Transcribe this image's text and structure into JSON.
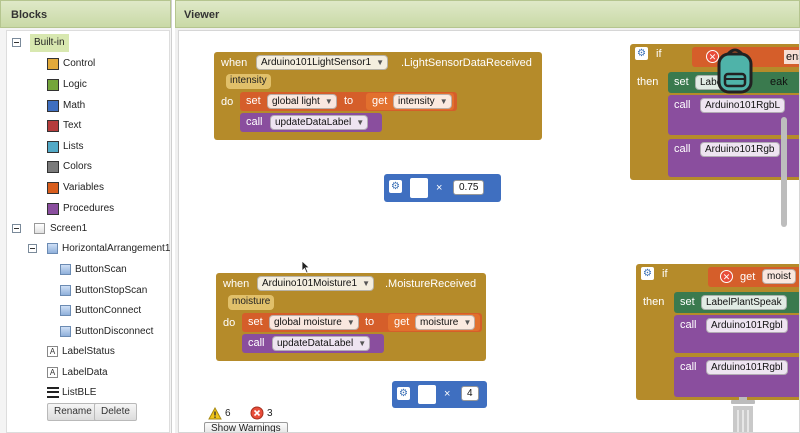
{
  "blocks_panel": {
    "title": "Blocks",
    "builtin": {
      "label": "Built-in",
      "categories": [
        {
          "label": "Control",
          "color": "#e1a93a"
        },
        {
          "label": "Logic",
          "color": "#74a53b"
        },
        {
          "label": "Math",
          "color": "#3f6fc0"
        },
        {
          "label": "Text",
          "color": "#b53c3c"
        },
        {
          "label": "Lists",
          "color": "#52a9c6"
        },
        {
          "label": "Colors",
          "color": "#7a7a7a"
        },
        {
          "label": "Variables",
          "color": "#d85d1d"
        },
        {
          "label": "Procedures",
          "color": "#8a4e9e"
        }
      ]
    },
    "screen": {
      "label": "Screen1",
      "arrangement": "HorizontalArrangement1",
      "buttons": [
        "ButtonScan",
        "ButtonStopScan",
        "ButtonConnect",
        "ButtonDisconnect"
      ],
      "labels": [
        "LabelStatus",
        "LabelData"
      ],
      "list": "ListBLE"
    },
    "rename_button": "Rename",
    "delete_button": "Delete"
  },
  "viewer": {
    "title": "Viewer",
    "event1": {
      "when": "when",
      "component": "Arduino101LightSensor1",
      "event": ".LightSensorDataReceived",
      "param": "intensity",
      "do": "do",
      "set": "set",
      "variable": "global light",
      "to": "to",
      "get": "get",
      "get_value": "intensity",
      "call": "call",
      "procedure": "updateDataLabel"
    },
    "multiply1": {
      "operator": "×",
      "value": "0.75"
    },
    "event2": {
      "when": "when",
      "component": "Arduino101Moisture1",
      "event": ".MoistureReceived",
      "param": "moisture",
      "do": "do",
      "set": "set",
      "variable": "global moisture",
      "to": "to",
      "get": "get",
      "get_value": "moisture",
      "call": "call",
      "procedure": "updateDataLabel"
    },
    "multiply2": {
      "operator": "×",
      "value": "4"
    },
    "right_block1": {
      "if": "if",
      "then": "then",
      "condition_fragment": "ensit",
      "set": "set",
      "set_target": "Labe",
      "set_fragment": "eak",
      "call1": "call",
      "call1_target": "Arduino101RgbL",
      "call2": "call",
      "call2_target": "Arduino101Rgb"
    },
    "right_block2": {
      "if": "if",
      "then": "then",
      "get": "get",
      "get_fragment": "moist",
      "set": "set",
      "set_target": "LabelPlantSpeak",
      "call1": "call",
      "call1_target": "Arduino101Rgbl",
      "call2": "call",
      "call2_target": "Arduino101Rgbl"
    },
    "warnings": {
      "warning_count": "6",
      "error_count": "3",
      "show_button": "Show Warnings"
    }
  }
}
